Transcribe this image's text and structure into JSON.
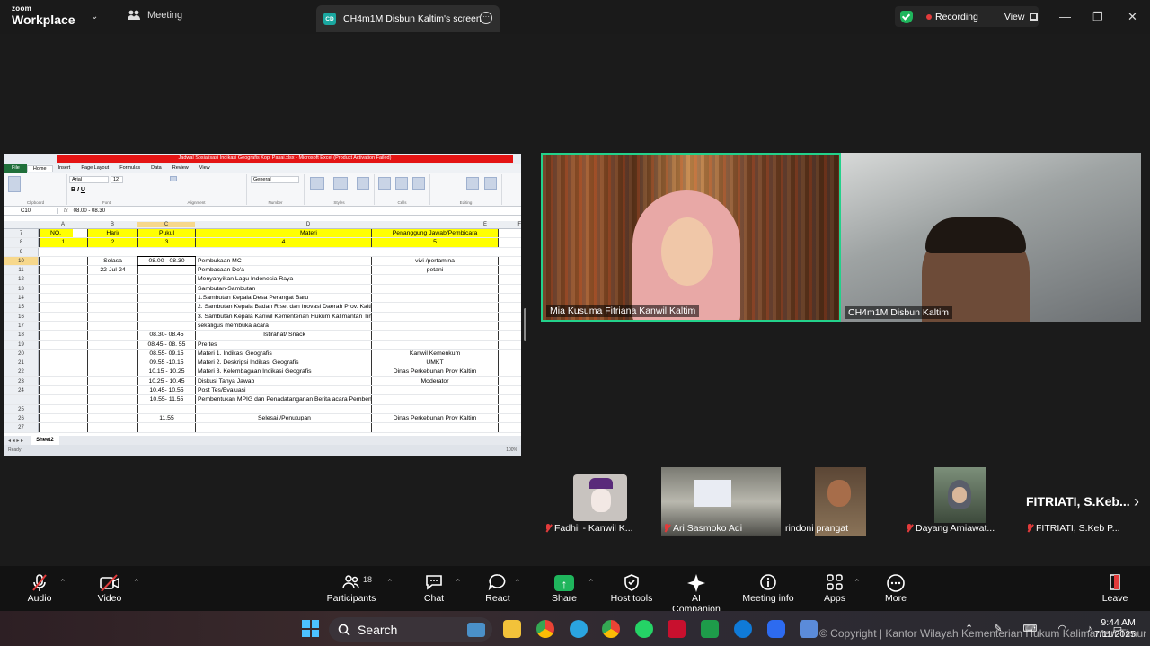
{
  "topbar": {
    "logo_top": "zoom",
    "logo_bottom": "Workplace",
    "meeting_label": "Meeting",
    "screen_badge": "CD",
    "screen_tab_label": "CH4m1M Disbun Kaltim's screen",
    "recording_label": "Recording",
    "view_label": "View",
    "minimize": "—",
    "restore": "❐",
    "close": "✕"
  },
  "excel": {
    "title": "Jadwal Sosialisasi Indikasi Geografis Kopi Pasai.xlsx - Microsoft Excel (Product Activation Failed)",
    "tabs": [
      "File",
      "Home",
      "Insert",
      "Page Layout",
      "Formulas",
      "Data",
      "Review",
      "View"
    ],
    "ribbon_groups": [
      "Clipboard",
      "Font",
      "Alignment",
      "Number",
      "Styles",
      "Cells",
      "Editing"
    ],
    "cell_ref": "C10",
    "formula": "08.00 - 08.30",
    "font_name": "Arial",
    "font_size": "12",
    "number_format": "General",
    "columns": [
      "A",
      "B",
      "C",
      "D",
      "E",
      "F"
    ],
    "header_row": {
      "no": "NO.",
      "hari": "Hari/",
      "pukul": "Pukul",
      "materi": "Materi",
      "pj": "Penanggung Jawab/Pembicara"
    },
    "index_row": {
      "no": "1",
      "hari": "2",
      "pukul": "3",
      "materi": "4",
      "pj": "5"
    },
    "rows": [
      {
        "r": "10",
        "b": "Selasa",
        "c": "08.00 - 08.30",
        "d": "Pembukaan MC",
        "e": "vivi /pertamina"
      },
      {
        "r": "11",
        "b": "22-Jul-24",
        "c": "",
        "d": "Pembacaan Do'a",
        "e": "petani"
      },
      {
        "r": "12",
        "b": "",
        "c": "",
        "d": "Menyanyikan Lagu Indonesia Raya",
        "e": ""
      },
      {
        "r": "13",
        "b": "",
        "c": "",
        "d": "Sambutan-Sambutan",
        "e": ""
      },
      {
        "r": "14",
        "b": "",
        "c": "",
        "d": "1.Sambutan Kepala Desa Perangat Baru",
        "e": ""
      },
      {
        "r": "15",
        "b": "",
        "c": "",
        "d": "2.  Sambutan Kepala Badan Riset dan Inovasi Daerah Prov. Kaltim",
        "e": ""
      },
      {
        "r": "16",
        "b": "",
        "c": "",
        "d": "3. Sambutan Kepala Kanwil Kementerian Hukum  Kalimantan Timur",
        "e": ""
      },
      {
        "r": "17",
        "b": "",
        "c": "",
        "d": "    sekaligus membuka acara",
        "e": ""
      },
      {
        "r": "18",
        "b": "",
        "c": "08.30- 08.45",
        "d": "Istirahat/ Snack",
        "e": "",
        "dcenter": true
      },
      {
        "r": "19",
        "b": "",
        "c": "08.45 - 08. 55",
        "d": "Pre tes",
        "e": ""
      },
      {
        "r": "20",
        "b": "",
        "c": "08.55- 09.15",
        "d": "Materi 1. Indikasi Geografis",
        "e": "Kanwil Kemenkum"
      },
      {
        "r": "21",
        "b": "",
        "c": "09.55 -10.15",
        "d": "Materi 2. Deskripsi Indikasi Geografis",
        "e": "UMKT"
      },
      {
        "r": "22",
        "b": "",
        "c": "10.15 - 10.25",
        "d": "Materi 3. Kelembagaan Indikasi Geografis",
        "e": "Dinas Perkebunan Prov Kaltim"
      },
      {
        "r": "23",
        "b": "",
        "c": "10.25  - 10.45",
        "d": "Diskusi Tanya Jawab",
        "e": "Moderator"
      },
      {
        "r": "24",
        "b": "",
        "c": "10.45- 10.55",
        "d": "Post Tes/Evaluasi",
        "e": ""
      },
      {
        "r": "",
        "b": "",
        "c": "10.55- 11.55",
        "d": "Pembentukan MPIG dan Penadatanganan Berita acara Pembentukan",
        "e": ""
      },
      {
        "r": "25",
        "b": "",
        "c": "",
        "d": "",
        "e": ""
      },
      {
        "r": "26",
        "b": "",
        "c": "11.55",
        "d": "Selesai /Penutupan",
        "e": "Dinas Perkebunan Prov Kaltim",
        "dcenter": true
      },
      {
        "r": "27",
        "b": "",
        "c": "",
        "d": "",
        "e": ""
      }
    ],
    "sheet_tab": "Sheet2",
    "status": "Ready",
    "zoom": "100%"
  },
  "participants_tiles": [
    {
      "name": "Mia Kusuma Fitriana Kanwil Kaltim"
    },
    {
      "name": "CH4m1M Disbun Kaltim"
    }
  ],
  "strip": [
    {
      "name": "Fadhil - Kanwil K...",
      "muted": true
    },
    {
      "name": "Ari Sasmoko Adi",
      "muted": true
    },
    {
      "name": "rindoni prangat",
      "muted": false
    },
    {
      "name": "Dayang Arniawat...",
      "muted": true
    },
    {
      "name": "FITRIATI, S.Keb P...",
      "muted": true
    }
  ],
  "strip_big_name": "FITRIATI,  S.Keb...",
  "toolbar": {
    "audio": "Audio",
    "video": "Video",
    "participants": "Participants",
    "participants_count": "18",
    "chat": "Chat",
    "react": "React",
    "share": "Share",
    "host_tools": "Host tools",
    "ai_companion": "AI Companion",
    "meeting_info": "Meeting info",
    "apps": "Apps",
    "more": "More",
    "leave": "Leave"
  },
  "taskbar": {
    "search_placeholder": "Search",
    "copyright": "© Copyright | Kantor Wilayah Kementerian Hukum Kalimantan Timur",
    "time": "9:44 AM",
    "date": "7/11/2025"
  },
  "colors": {
    "active_speaker": "#23d18b",
    "recording_dot": "#e23b3b",
    "share_green": "#1fb55c",
    "excel_yellow": "#ffff00",
    "excel_title_red": "#e41414"
  }
}
